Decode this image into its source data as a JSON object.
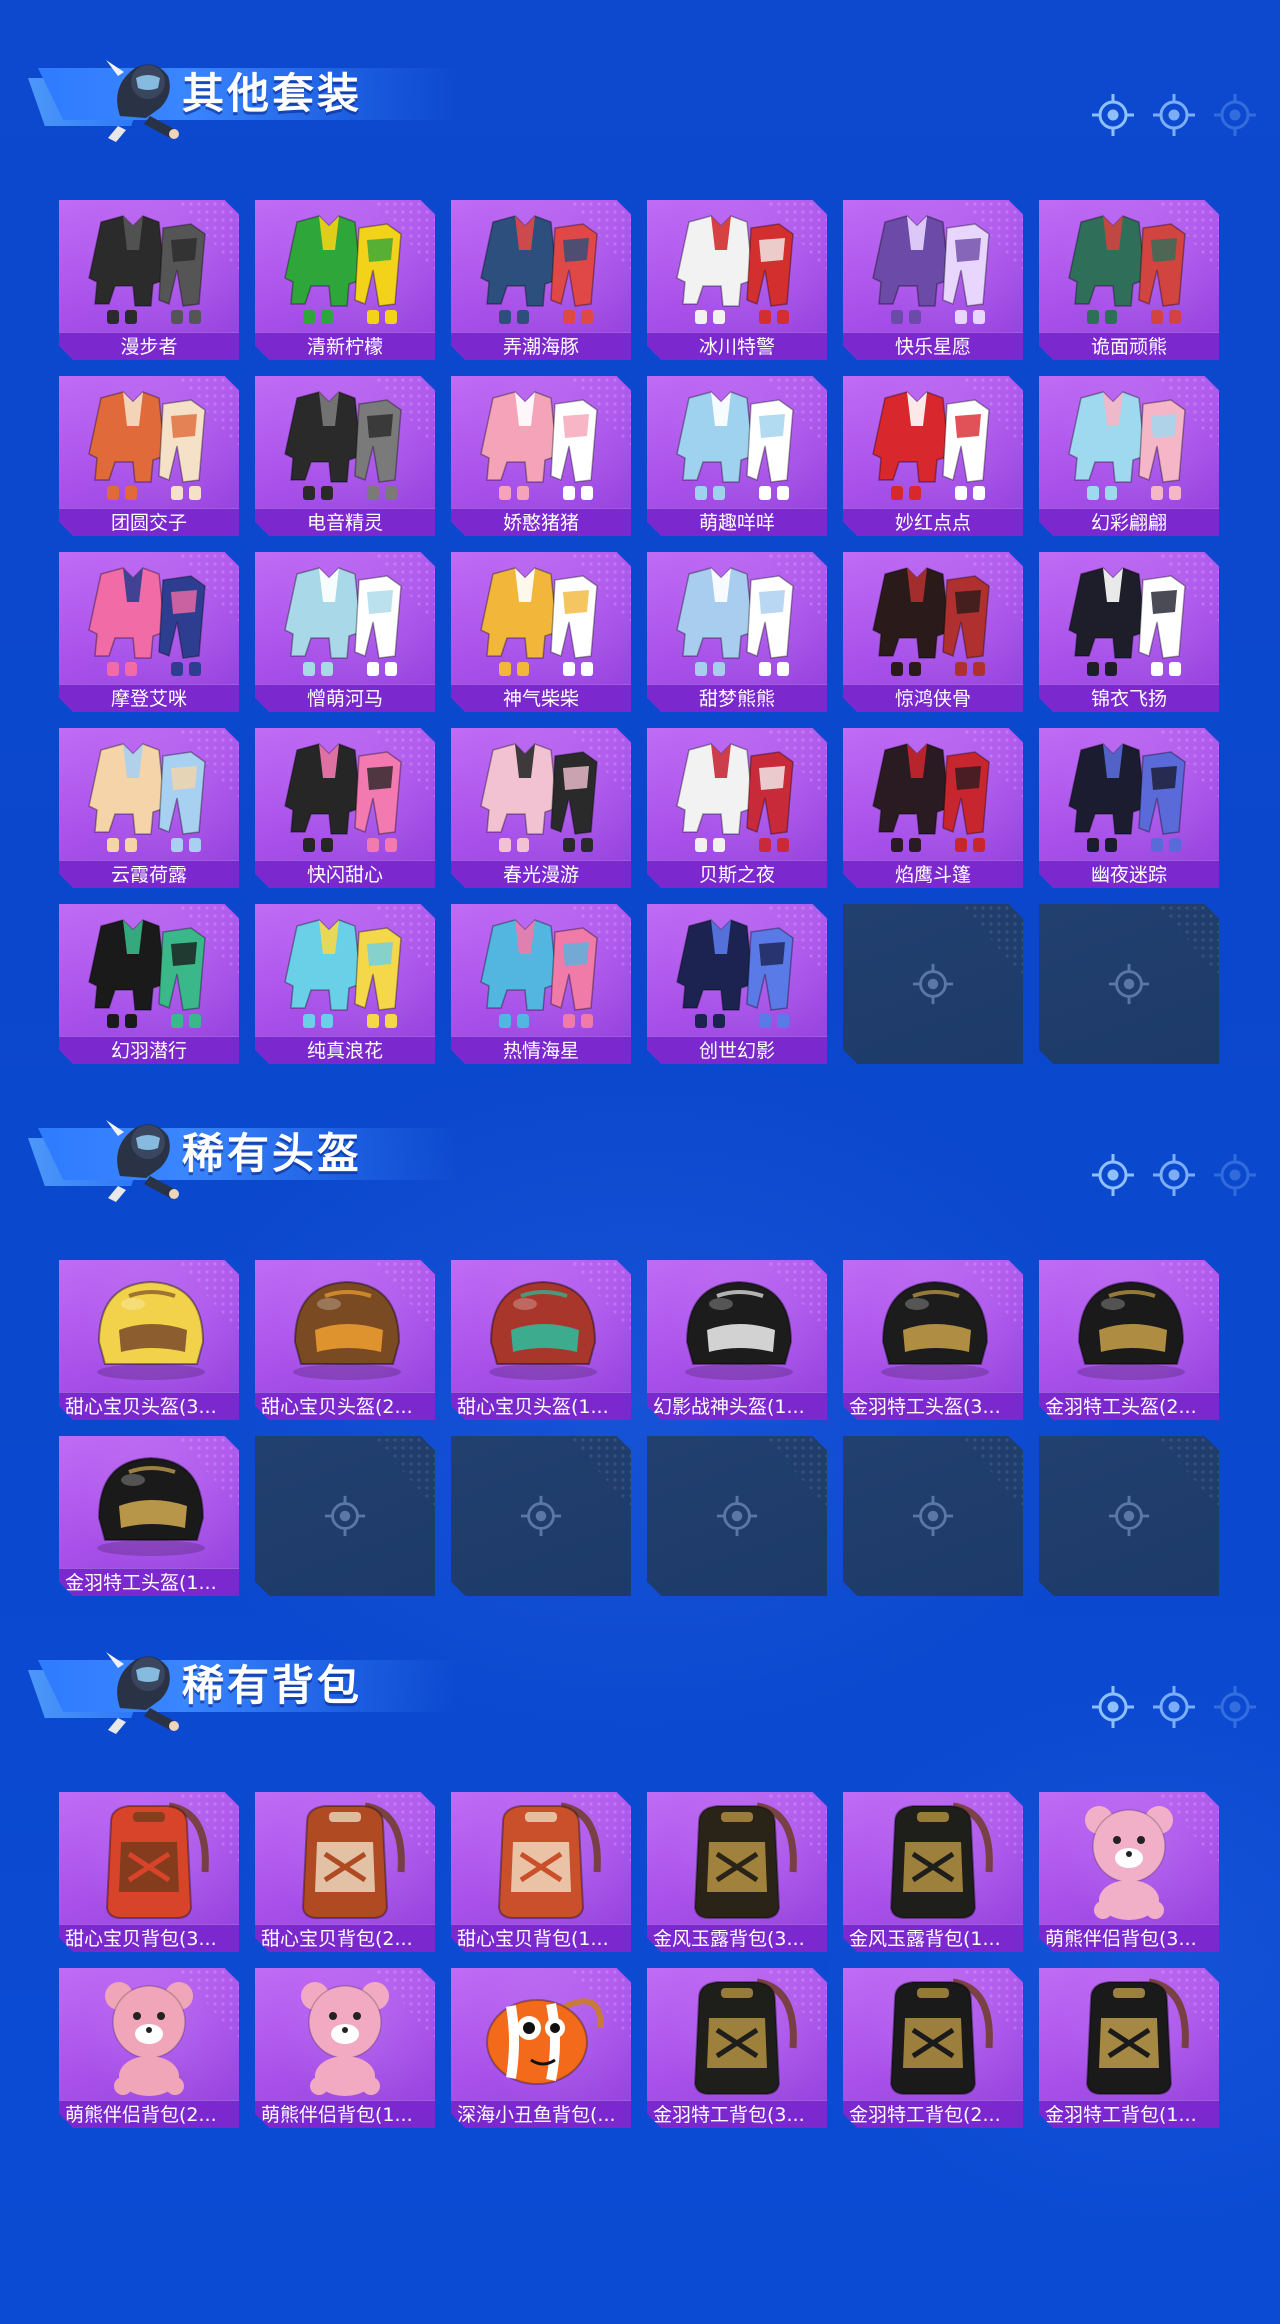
{
  "sections": [
    {
      "title": "其他套装",
      "items": [
        {
          "label": "漫步者",
          "kind": "outfit",
          "color": "#2b2b2b",
          "accent": "#555555"
        },
        {
          "label": "清新柠檬",
          "kind": "outfit",
          "color": "#2fa63a",
          "accent": "#f3d21a"
        },
        {
          "label": "弄潮海豚",
          "kind": "outfit",
          "color": "#2c4f7d",
          "accent": "#e04848"
        },
        {
          "label": "冰川特警",
          "kind": "outfit",
          "color": "#f2f2f2",
          "accent": "#d32f2f"
        },
        {
          "label": "快乐星愿",
          "kind": "outfit",
          "color": "#6b4aa8",
          "accent": "#e9d6ff"
        },
        {
          "label": "诡面顽熊",
          "kind": "outfit",
          "color": "#2f6f5a",
          "accent": "#d1443f"
        },
        {
          "label": "团圆交子",
          "kind": "outfit",
          "color": "#e06a3a",
          "accent": "#f5e0c8"
        },
        {
          "label": "电音精灵",
          "kind": "outfit",
          "color": "#2a2a2a",
          "accent": "#7a7a7a"
        },
        {
          "label": "娇憨猪猪",
          "kind": "outfit",
          "color": "#f5a3b8",
          "accent": "#ffffff"
        },
        {
          "label": "萌趣咩咩",
          "kind": "outfit",
          "color": "#9fd2ef",
          "accent": "#ffffff"
        },
        {
          "label": "妙红点点",
          "kind": "outfit",
          "color": "#d8272d",
          "accent": "#ffffff"
        },
        {
          "label": "幻彩翩翩",
          "kind": "outfit",
          "color": "#9fd9f0",
          "accent": "#f5b6c8"
        },
        {
          "label": "摩登艾咪",
          "kind": "outfit",
          "color": "#f16ba6",
          "accent": "#2d3e91"
        },
        {
          "label": "憎萌河马",
          "kind": "outfit",
          "color": "#a9d9e8",
          "accent": "#ffffff"
        },
        {
          "label": "神气柴柴",
          "kind": "outfit",
          "color": "#f1b63a",
          "accent": "#ffffff"
        },
        {
          "label": "甜梦熊熊",
          "kind": "outfit",
          "color": "#a8cdef",
          "accent": "#ffffff"
        },
        {
          "label": "惊鸿侠骨",
          "kind": "outfit",
          "color": "#2a1a1a",
          "accent": "#b0302f"
        },
        {
          "label": "锦衣飞扬",
          "kind": "outfit",
          "color": "#1e1e2a",
          "accent": "#ffffff"
        },
        {
          "label": "云霞荷露",
          "kind": "outfit",
          "color": "#f4d4a8",
          "accent": "#a8d0f0"
        },
        {
          "label": "快闪甜心",
          "kind": "outfit",
          "color": "#262626",
          "accent": "#f27ab0"
        },
        {
          "label": "春光漫游",
          "kind": "outfit",
          "color": "#f2c2d2",
          "accent": "#2a2a2a"
        },
        {
          "label": "贝斯之夜",
          "kind": "outfit",
          "color": "#f2f2f2",
          "accent": "#c82a3a"
        },
        {
          "label": "焰鹰斗篷",
          "kind": "outfit",
          "color": "#2a1a22",
          "accent": "#c8262e"
        },
        {
          "label": "幽夜迷踪",
          "kind": "outfit",
          "color": "#1c1c30",
          "accent": "#5a6ad8"
        },
        {
          "label": "幻羽潜行",
          "kind": "outfit",
          "color": "#1a1a1a",
          "accent": "#3ab88a"
        },
        {
          "label": "纯真浪花",
          "kind": "outfit",
          "color": "#6ad0e8",
          "accent": "#f5d84a"
        },
        {
          "label": "热情海星",
          "kind": "outfit",
          "color": "#52b6e0",
          "accent": "#f07aa8"
        },
        {
          "label": "创世幻影",
          "kind": "outfit",
          "color": "#1c2350",
          "accent": "#5a7ae8"
        },
        {
          "label": "",
          "kind": "empty"
        },
        {
          "label": "",
          "kind": "empty"
        }
      ]
    },
    {
      "title": "稀有头盔",
      "items": [
        {
          "label": "甜心宝贝头盔(3...",
          "kind": "helmet",
          "color": "#f2d24a",
          "accent": "#7a4a2a"
        },
        {
          "label": "甜心宝贝头盔(2...",
          "kind": "helmet",
          "color": "#7a4a22",
          "accent": "#f0a030"
        },
        {
          "label": "甜心宝贝头盔(1...",
          "kind": "helmet",
          "color": "#a8362a",
          "accent": "#2ac0a0"
        },
        {
          "label": "幻影战神头盔(1...",
          "kind": "helmet",
          "color": "#1c1c1c",
          "accent": "#f2f2f2"
        },
        {
          "label": "金羽特工头盔(3...",
          "kind": "helmet",
          "color": "#1c1c1c",
          "accent": "#c9a24a"
        },
        {
          "label": "金羽特工头盔(2...",
          "kind": "helmet",
          "color": "#1a1a1a",
          "accent": "#c9a24a"
        },
        {
          "label": "金羽特工头盔(1...",
          "kind": "helmet",
          "color": "#1a1a1a",
          "accent": "#d4ad52"
        },
        {
          "label": "",
          "kind": "empty"
        },
        {
          "label": "",
          "kind": "empty"
        },
        {
          "label": "",
          "kind": "empty"
        },
        {
          "label": "",
          "kind": "empty"
        },
        {
          "label": "",
          "kind": "empty"
        }
      ]
    },
    {
      "title": "稀有背包",
      "items": [
        {
          "label": "甜心宝贝背包(3...",
          "kind": "backpack",
          "color": "#d8442a",
          "accent": "#6a3a1a"
        },
        {
          "label": "甜心宝贝背包(2...",
          "kind": "backpack",
          "color": "#b04a22",
          "accent": "#f4ead2"
        },
        {
          "label": "甜心宝贝背包(1...",
          "kind": "backpack",
          "color": "#c9502a",
          "accent": "#f4ead2"
        },
        {
          "label": "金风玉露背包(3...",
          "kind": "backpack",
          "color": "#2a2418",
          "accent": "#c9a24a"
        },
        {
          "label": "金风玉露背包(1...",
          "kind": "backpack",
          "color": "#1e1e1a",
          "accent": "#c9a24a"
        },
        {
          "label": "萌熊伴侣背包(3...",
          "kind": "bear",
          "color": "#f2b0c8",
          "accent": "#ffffff"
        },
        {
          "label": "萌熊伴侣背包(2...",
          "kind": "bear",
          "color": "#f0a6b8",
          "accent": "#ffffff"
        },
        {
          "label": "萌熊伴侣背包(1...",
          "kind": "bear",
          "color": "#f2aac2",
          "accent": "#ffffff"
        },
        {
          "label": "深海小丑鱼背包(...",
          "kind": "fish",
          "color": "#f26a1a",
          "accent": "#ffffff"
        },
        {
          "label": "金羽特工背包(3...",
          "kind": "backpack",
          "color": "#1e1e1a",
          "accent": "#c9a24a"
        },
        {
          "label": "金羽特工背包(2...",
          "kind": "backpack",
          "color": "#1a1a1a",
          "accent": "#c9a24a"
        },
        {
          "label": "金羽特工背包(1...",
          "kind": "backpack",
          "color": "#1a1a1a",
          "accent": "#d4ad52"
        }
      ]
    }
  ]
}
